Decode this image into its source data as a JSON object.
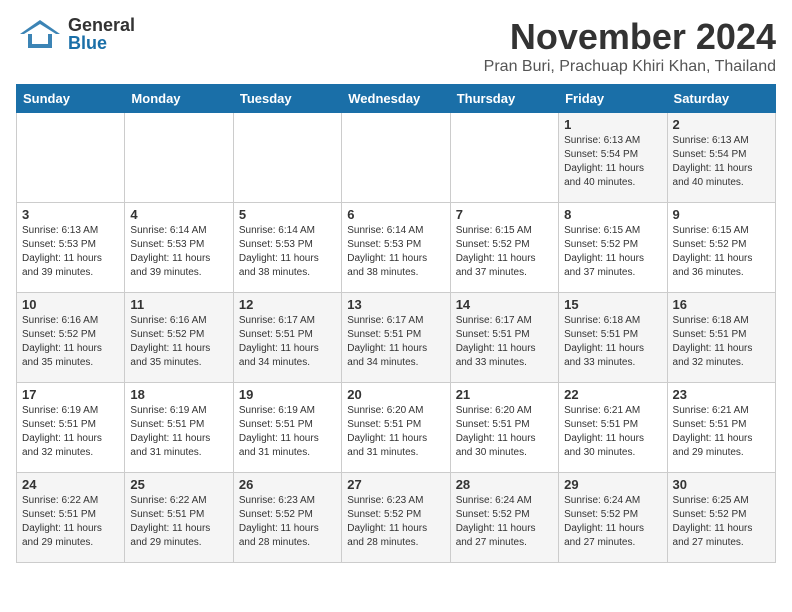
{
  "header": {
    "logo_general": "General",
    "logo_blue": "Blue",
    "month": "November 2024",
    "location": "Pran Buri, Prachuap Khiri Khan, Thailand"
  },
  "days_of_week": [
    "Sunday",
    "Monday",
    "Tuesday",
    "Wednesday",
    "Thursday",
    "Friday",
    "Saturday"
  ],
  "weeks": [
    [
      {
        "day": "",
        "info": ""
      },
      {
        "day": "",
        "info": ""
      },
      {
        "day": "",
        "info": ""
      },
      {
        "day": "",
        "info": ""
      },
      {
        "day": "",
        "info": ""
      },
      {
        "day": "1",
        "info": "Sunrise: 6:13 AM\nSunset: 5:54 PM\nDaylight: 11 hours and 40 minutes."
      },
      {
        "day": "2",
        "info": "Sunrise: 6:13 AM\nSunset: 5:54 PM\nDaylight: 11 hours and 40 minutes."
      }
    ],
    [
      {
        "day": "3",
        "info": "Sunrise: 6:13 AM\nSunset: 5:53 PM\nDaylight: 11 hours and 39 minutes."
      },
      {
        "day": "4",
        "info": "Sunrise: 6:14 AM\nSunset: 5:53 PM\nDaylight: 11 hours and 39 minutes."
      },
      {
        "day": "5",
        "info": "Sunrise: 6:14 AM\nSunset: 5:53 PM\nDaylight: 11 hours and 38 minutes."
      },
      {
        "day": "6",
        "info": "Sunrise: 6:14 AM\nSunset: 5:53 PM\nDaylight: 11 hours and 38 minutes."
      },
      {
        "day": "7",
        "info": "Sunrise: 6:15 AM\nSunset: 5:52 PM\nDaylight: 11 hours and 37 minutes."
      },
      {
        "day": "8",
        "info": "Sunrise: 6:15 AM\nSunset: 5:52 PM\nDaylight: 11 hours and 37 minutes."
      },
      {
        "day": "9",
        "info": "Sunrise: 6:15 AM\nSunset: 5:52 PM\nDaylight: 11 hours and 36 minutes."
      }
    ],
    [
      {
        "day": "10",
        "info": "Sunrise: 6:16 AM\nSunset: 5:52 PM\nDaylight: 11 hours and 35 minutes."
      },
      {
        "day": "11",
        "info": "Sunrise: 6:16 AM\nSunset: 5:52 PM\nDaylight: 11 hours and 35 minutes."
      },
      {
        "day": "12",
        "info": "Sunrise: 6:17 AM\nSunset: 5:51 PM\nDaylight: 11 hours and 34 minutes."
      },
      {
        "day": "13",
        "info": "Sunrise: 6:17 AM\nSunset: 5:51 PM\nDaylight: 11 hours and 34 minutes."
      },
      {
        "day": "14",
        "info": "Sunrise: 6:17 AM\nSunset: 5:51 PM\nDaylight: 11 hours and 33 minutes."
      },
      {
        "day": "15",
        "info": "Sunrise: 6:18 AM\nSunset: 5:51 PM\nDaylight: 11 hours and 33 minutes."
      },
      {
        "day": "16",
        "info": "Sunrise: 6:18 AM\nSunset: 5:51 PM\nDaylight: 11 hours and 32 minutes."
      }
    ],
    [
      {
        "day": "17",
        "info": "Sunrise: 6:19 AM\nSunset: 5:51 PM\nDaylight: 11 hours and 32 minutes."
      },
      {
        "day": "18",
        "info": "Sunrise: 6:19 AM\nSunset: 5:51 PM\nDaylight: 11 hours and 31 minutes."
      },
      {
        "day": "19",
        "info": "Sunrise: 6:19 AM\nSunset: 5:51 PM\nDaylight: 11 hours and 31 minutes."
      },
      {
        "day": "20",
        "info": "Sunrise: 6:20 AM\nSunset: 5:51 PM\nDaylight: 11 hours and 31 minutes."
      },
      {
        "day": "21",
        "info": "Sunrise: 6:20 AM\nSunset: 5:51 PM\nDaylight: 11 hours and 30 minutes."
      },
      {
        "day": "22",
        "info": "Sunrise: 6:21 AM\nSunset: 5:51 PM\nDaylight: 11 hours and 30 minutes."
      },
      {
        "day": "23",
        "info": "Sunrise: 6:21 AM\nSunset: 5:51 PM\nDaylight: 11 hours and 29 minutes."
      }
    ],
    [
      {
        "day": "24",
        "info": "Sunrise: 6:22 AM\nSunset: 5:51 PM\nDaylight: 11 hours and 29 minutes."
      },
      {
        "day": "25",
        "info": "Sunrise: 6:22 AM\nSunset: 5:51 PM\nDaylight: 11 hours and 29 minutes."
      },
      {
        "day": "26",
        "info": "Sunrise: 6:23 AM\nSunset: 5:52 PM\nDaylight: 11 hours and 28 minutes."
      },
      {
        "day": "27",
        "info": "Sunrise: 6:23 AM\nSunset: 5:52 PM\nDaylight: 11 hours and 28 minutes."
      },
      {
        "day": "28",
        "info": "Sunrise: 6:24 AM\nSunset: 5:52 PM\nDaylight: 11 hours and 27 minutes."
      },
      {
        "day": "29",
        "info": "Sunrise: 6:24 AM\nSunset: 5:52 PM\nDaylight: 11 hours and 27 minutes."
      },
      {
        "day": "30",
        "info": "Sunrise: 6:25 AM\nSunset: 5:52 PM\nDaylight: 11 hours and 27 minutes."
      }
    ]
  ]
}
